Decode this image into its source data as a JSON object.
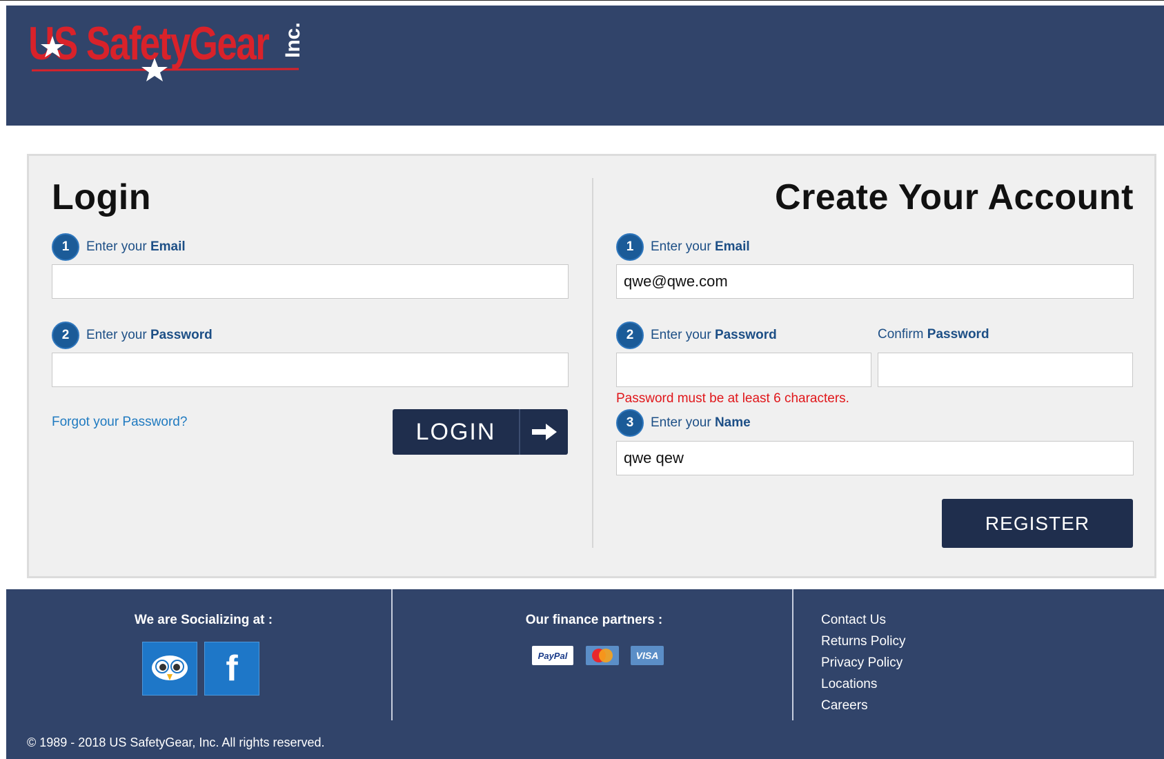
{
  "brand": {
    "logo_text": "US SafetyGear",
    "logo_suffix": "Inc.",
    "colors": {
      "header_bg": "#31446a",
      "logo_red": "#d9222a",
      "button_navy": "#1f2e4d",
      "step_badge": "#1b5b98"
    }
  },
  "login": {
    "title": "Login",
    "email_step": {
      "number": "1",
      "prefix": "Enter your",
      "label": "Email"
    },
    "email_value": "",
    "password_step": {
      "number": "2",
      "prefix": "Enter your",
      "label": "Password"
    },
    "password_value": "",
    "forgot_link": "Forgot your Password?",
    "button_label": "LOGIN",
    "button_icon": "arrow-right-icon"
  },
  "create_account": {
    "title": "Create Your Account",
    "email_step": {
      "number": "1",
      "prefix": "Enter your",
      "label": "Email"
    },
    "email_value": "qwe@qwe.com",
    "password_step": {
      "number": "2",
      "prefix": "Enter your",
      "label": "Password"
    },
    "password_value": "",
    "confirm_label_prefix": "Confirm",
    "confirm_label": "Password",
    "confirm_value": "",
    "password_error": "Password must be at least 6 characters.",
    "name_step": {
      "number": "3",
      "prefix": "Enter your",
      "label": "Name"
    },
    "name_value": "qwe qew",
    "register_button": "REGISTER"
  },
  "footer": {
    "social_title": "We are Socializing at :",
    "social_icons": [
      "owl-icon",
      "facebook-icon"
    ],
    "finance_title": "Our finance partners :",
    "finance_icons": [
      "paypal-icon",
      "mastercard-icon",
      "visa-icon"
    ],
    "paypal_text": "PayPal",
    "visa_text": "VISA",
    "facebook_glyph": "f",
    "links": [
      "Contact Us",
      "Returns Policy",
      "Privacy Policy",
      "Locations",
      "Careers"
    ],
    "copyright": "© 1989 - 2018 US SafetyGear, Inc. All rights reserved."
  }
}
